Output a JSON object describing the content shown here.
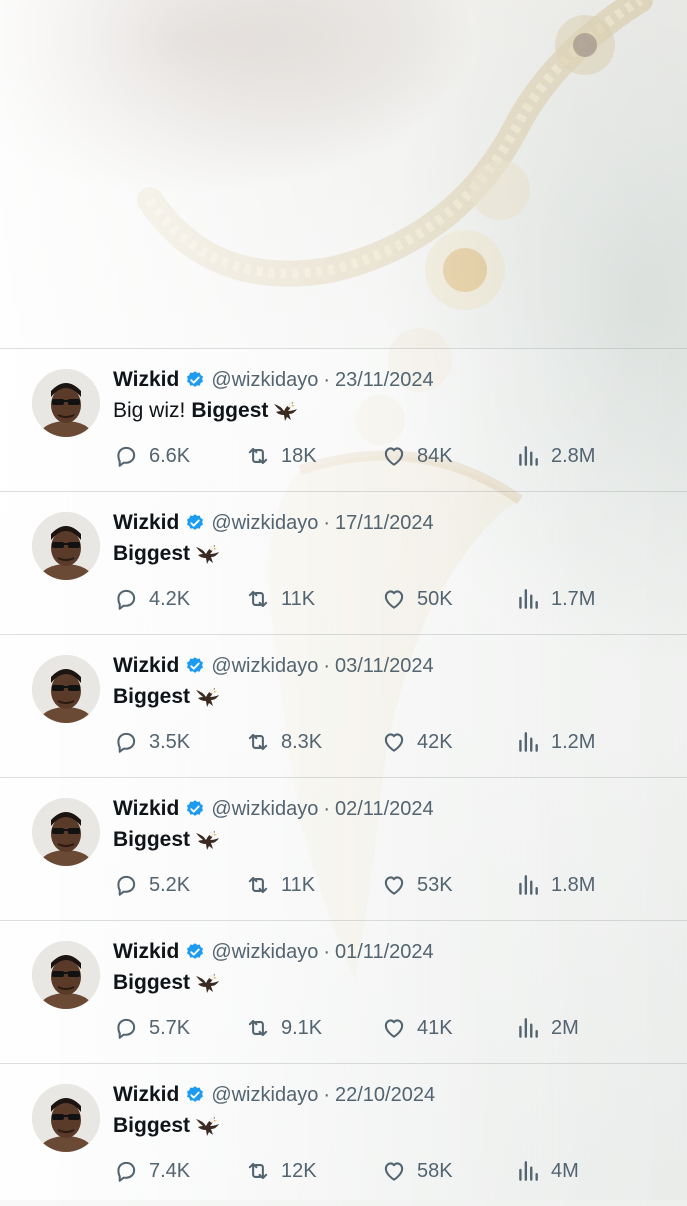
{
  "colors": {
    "text": "#0f1419",
    "secondary": "#536471",
    "verified": "#1d9bf0"
  },
  "icons": {
    "reply": "speech-bubble-icon",
    "retweet": "retweet-arrows-icon",
    "like": "heart-icon",
    "views": "bar-chart-icon",
    "verified": "verified-badge-icon",
    "emoji": "eagle-emoji"
  },
  "tweets": [
    {
      "name": "Wizkid",
      "handle": "@wizkidayo",
      "separator": "·",
      "date": "23/11/2024",
      "text_plain": "Big wiz!",
      "text_bold": "Biggest",
      "replies": "6.6K",
      "retweets": "18K",
      "likes": "84K",
      "views": "2.8M"
    },
    {
      "name": "Wizkid",
      "handle": "@wizkidayo",
      "separator": "·",
      "date": "17/11/2024",
      "text_plain": "",
      "text_bold": "Biggest",
      "replies": "4.2K",
      "retweets": "11K",
      "likes": "50K",
      "views": "1.7M"
    },
    {
      "name": "Wizkid",
      "handle": "@wizkidayo",
      "separator": "·",
      "date": "03/11/2024",
      "text_plain": "",
      "text_bold": "Biggest",
      "replies": "3.5K",
      "retweets": "8.3K",
      "likes": "42K",
      "views": "1.2M"
    },
    {
      "name": "Wizkid",
      "handle": "@wizkidayo",
      "separator": "·",
      "date": "02/11/2024",
      "text_plain": "",
      "text_bold": "Biggest",
      "replies": "5.2K",
      "retweets": "11K",
      "likes": "53K",
      "views": "1.8M"
    },
    {
      "name": "Wizkid",
      "handle": "@wizkidayo",
      "separator": "·",
      "date": "01/11/2024",
      "text_plain": "",
      "text_bold": "Biggest",
      "replies": "5.7K",
      "retweets": "9.1K",
      "likes": "41K",
      "views": "2M"
    },
    {
      "name": "Wizkid",
      "handle": "@wizkidayo",
      "separator": "·",
      "date": "22/10/2024",
      "text_plain": "",
      "text_bold": "Biggest",
      "replies": "7.4K",
      "retweets": "12K",
      "likes": "58K",
      "views": "4M"
    }
  ]
}
